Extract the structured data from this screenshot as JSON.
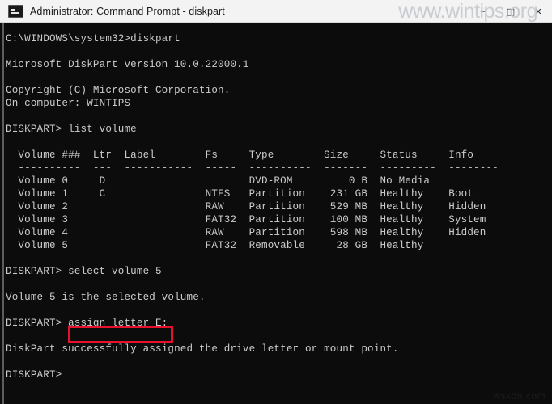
{
  "window": {
    "title": "Administrator: Command Prompt - diskpart",
    "icon": "console-icon",
    "controls": [
      {
        "name": "minimize-button",
        "glyph": "─"
      },
      {
        "name": "maximize-button",
        "glyph": "□"
      },
      {
        "name": "close-button",
        "glyph": "✕"
      }
    ]
  },
  "watermarks": {
    "top": "www.wintips.org",
    "bottom": "wsxdn.com"
  },
  "highlight": {
    "color": "#e8112d",
    "target_text": "assign letter E:"
  },
  "terminal": {
    "background": "#0c0c0c",
    "foreground": "#cccccc",
    "prompt_path": "C:\\WINDOWS\\system32>",
    "diskpart_prompt": "DISKPART>",
    "lines": [
      "C:\\WINDOWS\\system32>diskpart",
      "",
      "Microsoft DiskPart version 10.0.22000.1",
      "",
      "Copyright (C) Microsoft Corporation.",
      "On computer: WINTIPS",
      "",
      "DISKPART> list volume",
      "",
      "  Volume ###  Ltr  Label        Fs     Type        Size     Status     Info",
      "  ----------  ---  -----------  -----  ----------  -------  ---------  --------",
      "  Volume 0     D                       DVD-ROM         0 B  No Media",
      "  Volume 1     C                NTFS   Partition    231 GB  Healthy    Boot",
      "  Volume 2                      RAW    Partition    529 MB  Healthy    Hidden",
      "  Volume 3                      FAT32  Partition    100 MB  Healthy    System",
      "  Volume 4                      RAW    Partition    598 MB  Healthy    Hidden",
      "  Volume 5                      FAT32  Removable     28 GB  Healthy",
      "",
      "DISKPART> select volume 5",
      "",
      "Volume 5 is the selected volume.",
      "",
      "DISKPART> assign letter E:",
      "",
      "DiskPart successfully assigned the drive letter or mount point.",
      "",
      "DISKPART>"
    ],
    "volume_table": {
      "headers": [
        "Volume ###",
        "Ltr",
        "Label",
        "Fs",
        "Type",
        "Size",
        "Status",
        "Info"
      ],
      "rows": [
        {
          "volume": "Volume 0",
          "ltr": "D",
          "label": "",
          "fs": "",
          "type": "DVD-ROM",
          "size": "0 B",
          "status": "No Media",
          "info": ""
        },
        {
          "volume": "Volume 1",
          "ltr": "C",
          "label": "",
          "fs": "NTFS",
          "type": "Partition",
          "size": "231 GB",
          "status": "Healthy",
          "info": "Boot"
        },
        {
          "volume": "Volume 2",
          "ltr": "",
          "label": "",
          "fs": "RAW",
          "type": "Partition",
          "size": "529 MB",
          "status": "Healthy",
          "info": "Hidden"
        },
        {
          "volume": "Volume 3",
          "ltr": "",
          "label": "",
          "fs": "FAT32",
          "type": "Partition",
          "size": "100 MB",
          "status": "Healthy",
          "info": "System"
        },
        {
          "volume": "Volume 4",
          "ltr": "",
          "label": "",
          "fs": "RAW",
          "type": "Partition",
          "size": "598 MB",
          "status": "Healthy",
          "info": "Hidden"
        },
        {
          "volume": "Volume 5",
          "ltr": "",
          "label": "",
          "fs": "FAT32",
          "type": "Removable",
          "size": "28 GB",
          "status": "Healthy",
          "info": ""
        }
      ]
    },
    "commands": [
      "diskpart",
      "list volume",
      "select volume 5",
      "assign letter E:"
    ],
    "messages": [
      "Microsoft DiskPart version 10.0.22000.1",
      "Copyright (C) Microsoft Corporation.",
      "On computer: WINTIPS",
      "Volume 5 is the selected volume.",
      "DiskPart successfully assigned the drive letter or mount point."
    ]
  }
}
